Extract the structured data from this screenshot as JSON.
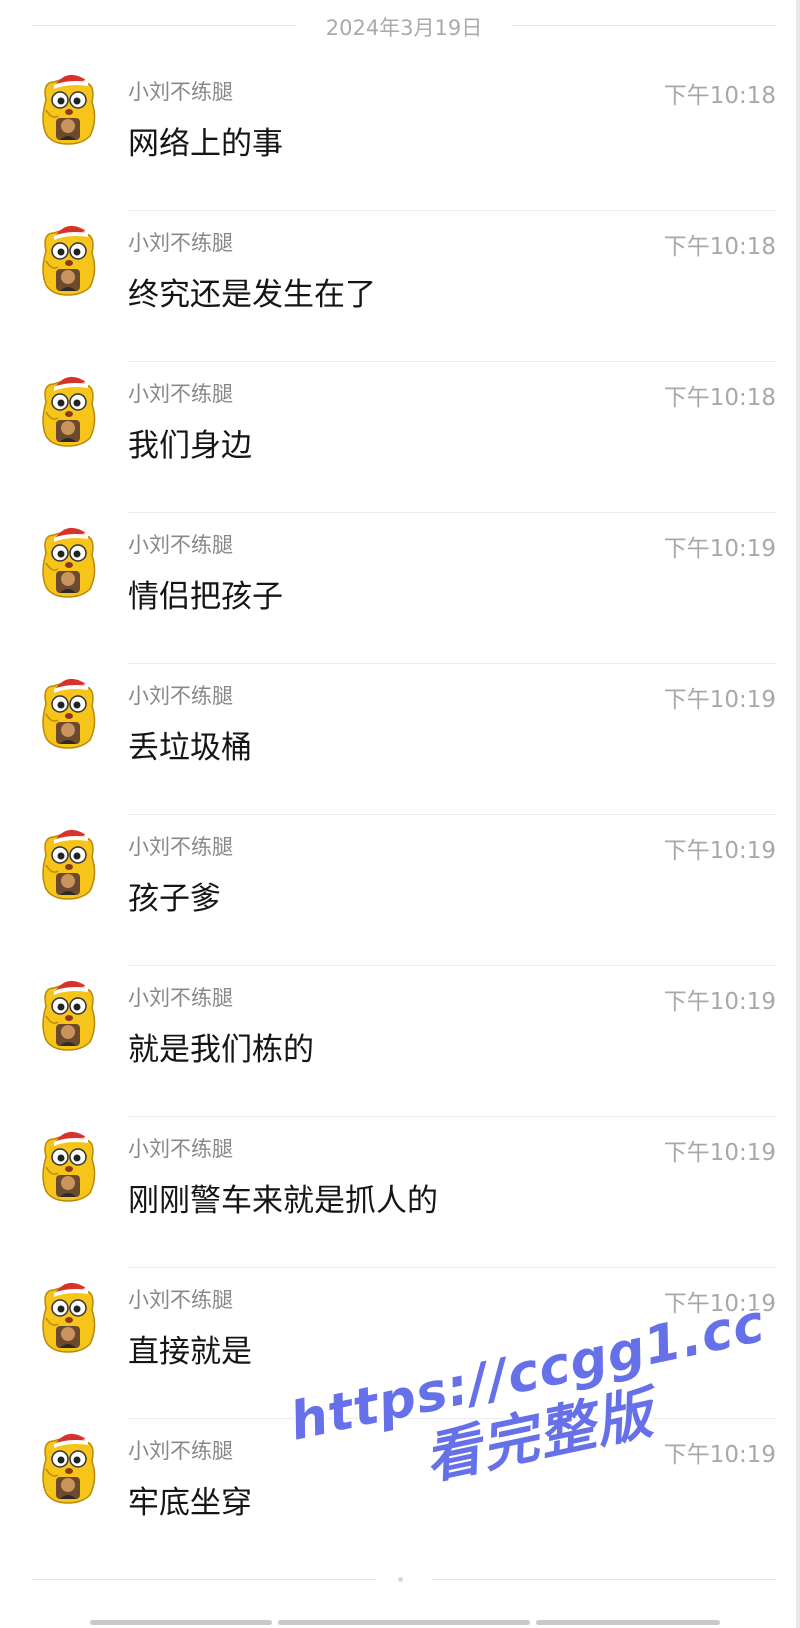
{
  "chat": {
    "date": "2024年3月19日",
    "messages": [
      {
        "sender": "小刘不练腿",
        "time": "下午10:18",
        "text": "网络上的事"
      },
      {
        "sender": "小刘不练腿",
        "time": "下午10:18",
        "text": "终究还是发生在了"
      },
      {
        "sender": "小刘不练腿",
        "time": "下午10:18",
        "text": "我们身边"
      },
      {
        "sender": "小刘不练腿",
        "time": "下午10:19",
        "text": "情侣把孩子"
      },
      {
        "sender": "小刘不练腿",
        "time": "下午10:19",
        "text": "丢垃圾桶"
      },
      {
        "sender": "小刘不练腿",
        "time": "下午10:19",
        "text": "孩子爹"
      },
      {
        "sender": "小刘不练腿",
        "time": "下午10:19",
        "text": "就是我们栋的"
      },
      {
        "sender": "小刘不练腿",
        "time": "下午10:19",
        "text": "刚刚警车来就是抓人的"
      },
      {
        "sender": "小刘不练腿",
        "time": "下午10:19",
        "text": "直接就是"
      },
      {
        "sender": "小刘不练腿",
        "time": "下午10:19",
        "text": "牢底坐穿"
      }
    ]
  },
  "watermark": {
    "line1": "https://ccgg1.cc",
    "line2": "看完整版"
  },
  "colors": {
    "watermark": "#5a66e8",
    "avatar_body": "#f7c51a",
    "avatar_hat": "#d8332a"
  },
  "icons": {
    "avatar": "cartoon-cat-avatar"
  }
}
